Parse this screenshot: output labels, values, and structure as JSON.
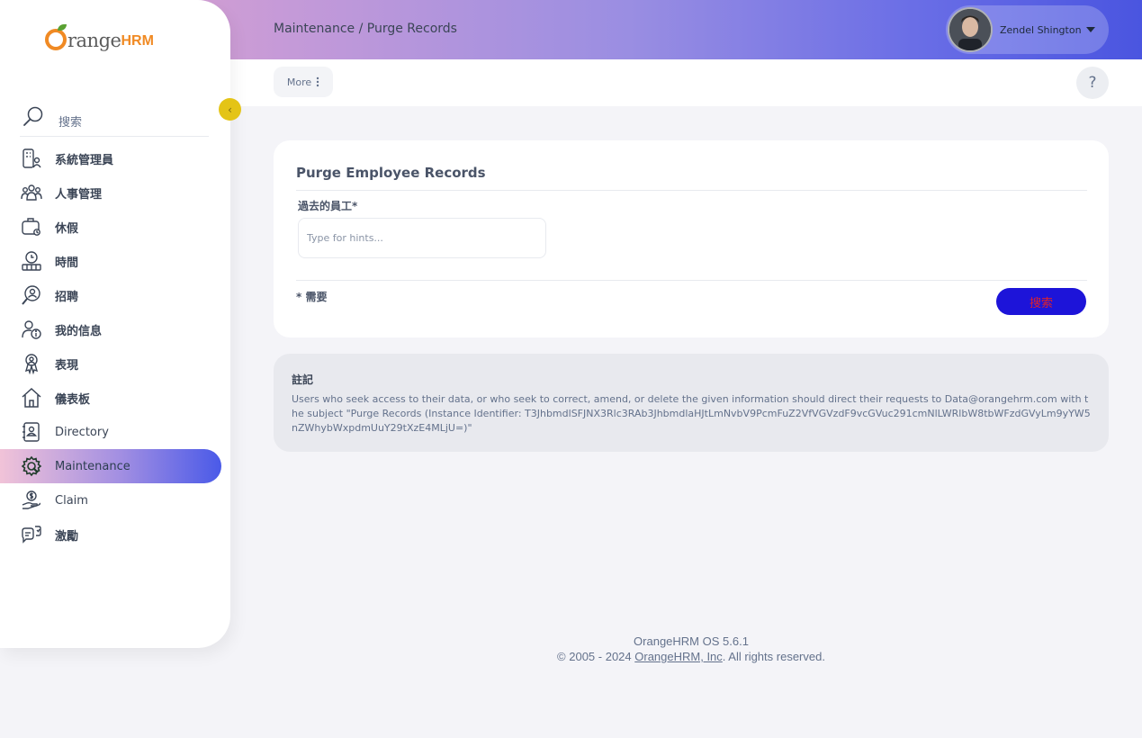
{
  "header": {
    "breadcrumb": "Maintenance / Purge Records",
    "user_name": "Zendel Shington"
  },
  "subbar": {
    "more_label": "More",
    "help_label": "?"
  },
  "logo": {
    "orange": "range",
    "hrm": "HRM"
  },
  "sidebar": {
    "search_label": "搜索",
    "collapse_label": "‹",
    "items": [
      {
        "label": "系統管理員",
        "icon": "admin-icon"
      },
      {
        "label": "人事管理",
        "icon": "pim-icon"
      },
      {
        "label": "休假",
        "icon": "leave-icon"
      },
      {
        "label": "時間",
        "icon": "time-icon"
      },
      {
        "label": "招聘",
        "icon": "recruitment-icon"
      },
      {
        "label": "我的信息",
        "icon": "my-info-icon"
      },
      {
        "label": "表現",
        "icon": "performance-icon"
      },
      {
        "label": "儀表板",
        "icon": "dashboard-icon"
      },
      {
        "label": "Directory",
        "icon": "directory-icon"
      },
      {
        "label": "Maintenance",
        "icon": "maintenance-icon",
        "active": true
      },
      {
        "label": "Claim",
        "icon": "claim-icon"
      },
      {
        "label": "激勵",
        "icon": "buzz-icon"
      }
    ]
  },
  "card": {
    "title": "Purge Employee Records",
    "field_label": "過去的員工*",
    "field_placeholder": "Type for hints...",
    "field_value": "",
    "required_text": "* 需要",
    "search_button": "搜索"
  },
  "note": {
    "title": "註記",
    "body": "Users who seek access to their data, or who seek to correct, amend, or delete the given information should direct their requests to Data@orangehrm.com with the subject \"Purge Records (Instance Identifier: T3JhbmdlSFJNX3Rlc3RAb3JhbmdlaHJtLmNvbV9PcmFuZ2VfVGVzdF9vcGVuc291cmNlLWRlbW8tbWFzdGVyLm9yYW5nZWhybWxpdmUuY29tXzE4MLjU=)\""
  },
  "footer": {
    "version": "OrangeHRM OS 5.6.1",
    "copyright_prefix": "© 2005 - 2024 ",
    "company": "OrangeHRM, Inc",
    "copyright_suffix": ". All rights reserved."
  },
  "colors": {
    "accent": "#1d14d9",
    "button_text": "#e0222a",
    "brand_orange": "#f08a24",
    "toggle_yellow": "#e4c416"
  }
}
